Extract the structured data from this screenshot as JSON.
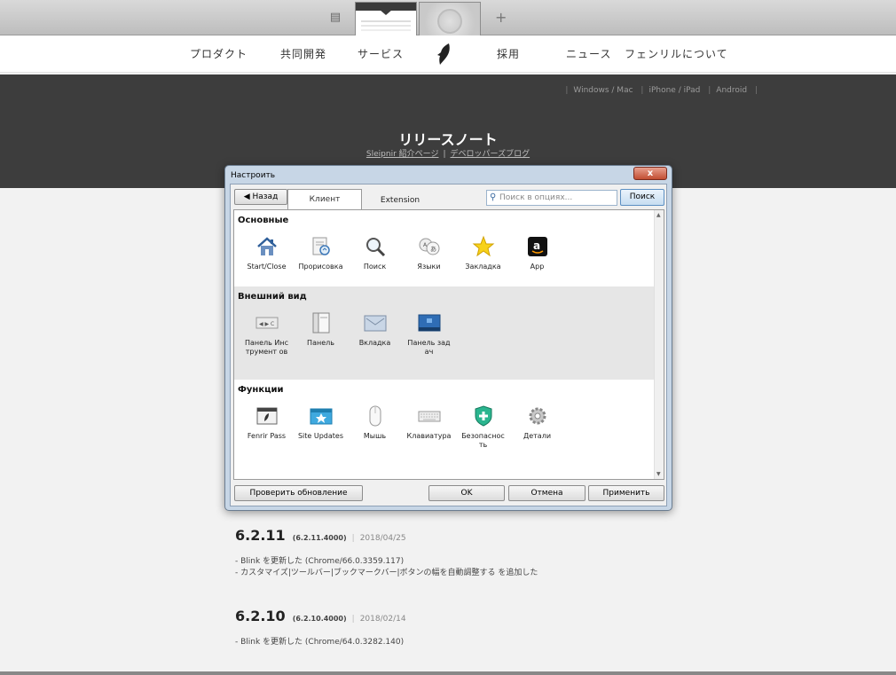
{
  "browser": {
    "tabs_button_icon": "tabs-icon",
    "new_tab_label": "+"
  },
  "site_nav": {
    "items": [
      "プロダクト",
      "共同開発",
      "サービス",
      "採用",
      "ニュース",
      "フェンリルについて"
    ]
  },
  "header": {
    "platforms": [
      "Windows / Mac",
      "iPhone / iPad",
      "Android"
    ],
    "title": "リリースノート",
    "links": [
      "Sleipnir 紹介ページ",
      "デベロッパーズブログ"
    ]
  },
  "dialog": {
    "title": "Настроить",
    "close_label": "x",
    "back_label": "◀ Назад",
    "tabs": [
      {
        "label": "Клиент",
        "active": true
      },
      {
        "label": "Extension",
        "active": false
      }
    ],
    "search_placeholder": "Поиск в опциях...",
    "search_button": "Поиск",
    "sections": [
      {
        "title": "Основные",
        "items": [
          {
            "label": "Start/Close",
            "icon": "house-icon"
          },
          {
            "label": "Прорисовка",
            "icon": "page-render-icon"
          },
          {
            "label": "Поиск",
            "icon": "magnifier-icon"
          },
          {
            "label": "Языки",
            "icon": "languages-icon"
          },
          {
            "label": "Закладка",
            "icon": "star-icon"
          },
          {
            "label": "App",
            "icon": "amazon-app-icon"
          }
        ]
      },
      {
        "title": "Внешний вид",
        "items": [
          {
            "label": "Панель Инструмент ов",
            "icon": "toolbar-icon"
          },
          {
            "label": "Панель",
            "icon": "panel-icon"
          },
          {
            "label": "Вкладка",
            "icon": "tab-icon"
          },
          {
            "label": "Панель задач",
            "icon": "taskbar-icon"
          }
        ]
      },
      {
        "title": "Функции",
        "items": [
          {
            "label": "Fenrir Pass",
            "icon": "fenrir-pass-icon"
          },
          {
            "label": "Site Updates",
            "icon": "site-updates-icon"
          },
          {
            "label": "Мышь",
            "icon": "mouse-icon"
          },
          {
            "label": "Клавиатура",
            "icon": "keyboard-icon"
          },
          {
            "label": "Безопаснос ть",
            "icon": "shield-icon"
          },
          {
            "label": "Детали",
            "icon": "gear-icon"
          }
        ]
      }
    ],
    "footer": {
      "update_button": "Проверить обновление",
      "ok_button": "OK",
      "cancel_button": "Отмена",
      "apply_button": "Применить"
    }
  },
  "releases": [
    {
      "version": "6.2.11",
      "build": "(6.2.11.4000)",
      "date": "2018/04/25",
      "changes": [
        "-  Blink を更新した (Chrome/66.0.3359.117)",
        "-  カスタマイズ|ツールバー|ブックマークバー|ボタンの幅を自動調整する を追加した"
      ]
    },
    {
      "version": "6.2.10",
      "build": "(6.2.10.4000)",
      "date": "2018/02/14",
      "changes": [
        "-  Blink を更新した (Chrome/64.0.3282.140)"
      ]
    }
  ]
}
